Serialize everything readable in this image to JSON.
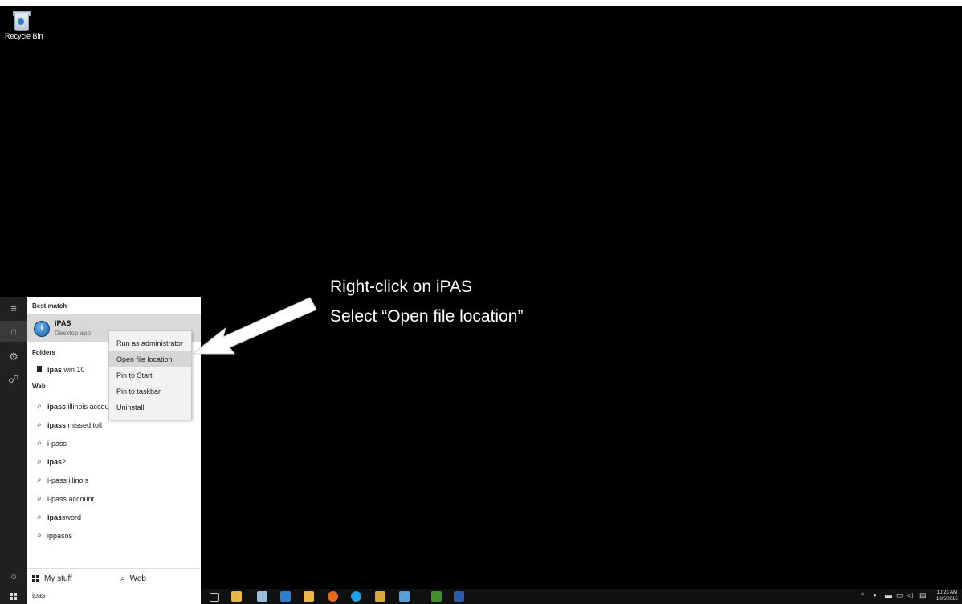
{
  "desktop": {
    "recycle_bin_label": "Recycle Bin"
  },
  "start_menu": {
    "best_match_heading": "Best match",
    "best_match": {
      "name": "iPAS",
      "subtitle": "Desktop app"
    },
    "folders_heading": "Folders",
    "folders": [
      {
        "bold": "ipas",
        "rest": " win 10"
      }
    ],
    "web_heading": "Web",
    "web_results": [
      {
        "bold": "ipass",
        "rest": " illinois accou"
      },
      {
        "bold": "ipass",
        "rest": " missed toll"
      },
      {
        "bold": "",
        "rest": "i-pass"
      },
      {
        "bold": "ipas",
        "rest": "2"
      },
      {
        "bold": "",
        "rest": "i-pass illinois"
      },
      {
        "bold": "",
        "rest": "i-pass account"
      },
      {
        "bold": "ipas",
        "rest": "sword"
      },
      {
        "bold": "",
        "rest": "ippasos"
      }
    ],
    "bottom_tabs": {
      "my_stuff": "My stuff",
      "web": "Web"
    },
    "search_query": "ipas"
  },
  "context_menu": {
    "items": [
      "Run as administrator",
      "Open file location",
      "Pin to Start",
      "Pin to taskbar",
      "Uninstall"
    ],
    "highlighted_index": 1
  },
  "annotation": {
    "line1": "Right-click on iPAS",
    "line2": "Select “Open file location”"
  },
  "taskbar": {
    "clock_time": "10:23 AM",
    "clock_date": "10/5/2015",
    "pinned_apps": [
      {
        "icon": "task-view-icon",
        "color": "#cccccc"
      },
      {
        "icon": "file-explorer-icon",
        "color": "#e6b84a"
      },
      {
        "icon": "paint-icon",
        "color": "#9bbbd8"
      },
      {
        "icon": "outlook-icon",
        "color": "#2f7fd0"
      },
      {
        "icon": "file-manager-icon",
        "color": "#e8b84f"
      },
      {
        "icon": "firefox-icon",
        "color": "#e56b1f"
      },
      {
        "icon": "skype-icon",
        "color": "#1ea1e3"
      },
      {
        "icon": "folder-icon",
        "color": "#d9a93d"
      },
      {
        "icon": "cloud-icon",
        "color": "#5aa0d8"
      },
      {
        "icon": "dreamweaver-icon",
        "color": "#3f8f2f"
      },
      {
        "icon": "photoshop-icon",
        "color": "#2c5aa6"
      }
    ]
  }
}
